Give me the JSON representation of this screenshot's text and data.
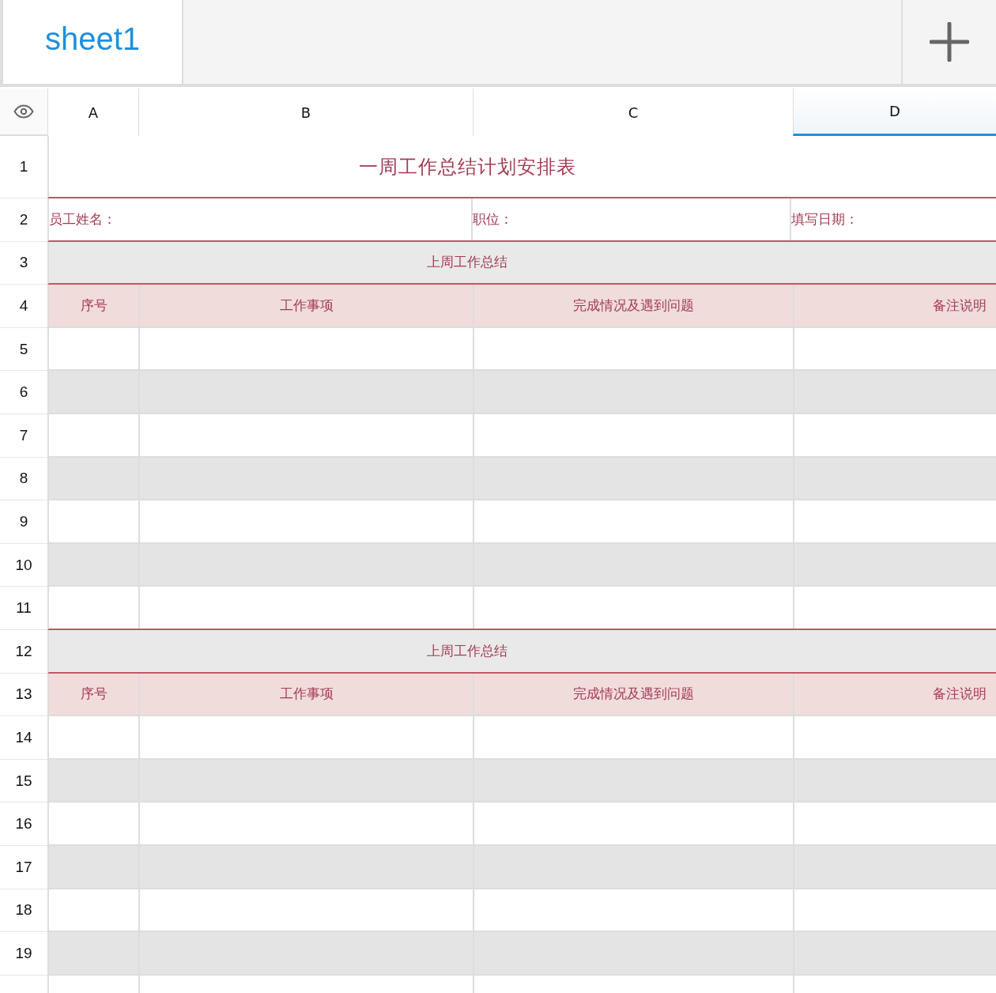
{
  "tabs": [
    {
      "label": "sheet1",
      "selected": true
    }
  ],
  "columns": [
    {
      "label": "A",
      "selected": false
    },
    {
      "label": "B",
      "selected": false
    },
    {
      "label": "C",
      "selected": false
    },
    {
      "label": "D",
      "selected": true
    }
  ],
  "rows": [
    {
      "number": "1",
      "kind": "title",
      "text": "一周工作总结计划安排表"
    },
    {
      "number": "2",
      "kind": "info",
      "cells": [
        "员工姓名：",
        "职位：",
        "填写日期："
      ]
    },
    {
      "number": "3",
      "kind": "section",
      "text": "上周工作总结"
    },
    {
      "number": "4",
      "kind": "header",
      "cells": [
        "序号",
        "工作事项",
        "完成情况及遇到问题",
        "备注说明"
      ]
    },
    {
      "number": "5",
      "kind": "blank",
      "shaded": false
    },
    {
      "number": "6",
      "kind": "blank",
      "shaded": true
    },
    {
      "number": "7",
      "kind": "blank",
      "shaded": false
    },
    {
      "number": "8",
      "kind": "blank",
      "shaded": true
    },
    {
      "number": "9",
      "kind": "blank",
      "shaded": false
    },
    {
      "number": "10",
      "kind": "blank",
      "shaded": true
    },
    {
      "number": "11",
      "kind": "blank",
      "shaded": false
    },
    {
      "number": "12",
      "kind": "section",
      "text": "上周工作总结"
    },
    {
      "number": "13",
      "kind": "header",
      "cells": [
        "序号",
        "工作事项",
        "完成情况及遇到问题",
        "备注说明"
      ]
    },
    {
      "number": "14",
      "kind": "blank",
      "shaded": false
    },
    {
      "number": "15",
      "kind": "blank",
      "shaded": true
    },
    {
      "number": "16",
      "kind": "blank",
      "shaded": false
    },
    {
      "number": "17",
      "kind": "blank",
      "shaded": true
    },
    {
      "number": "18",
      "kind": "blank",
      "shaded": false
    },
    {
      "number": "19",
      "kind": "blank",
      "shaded": true
    }
  ]
}
